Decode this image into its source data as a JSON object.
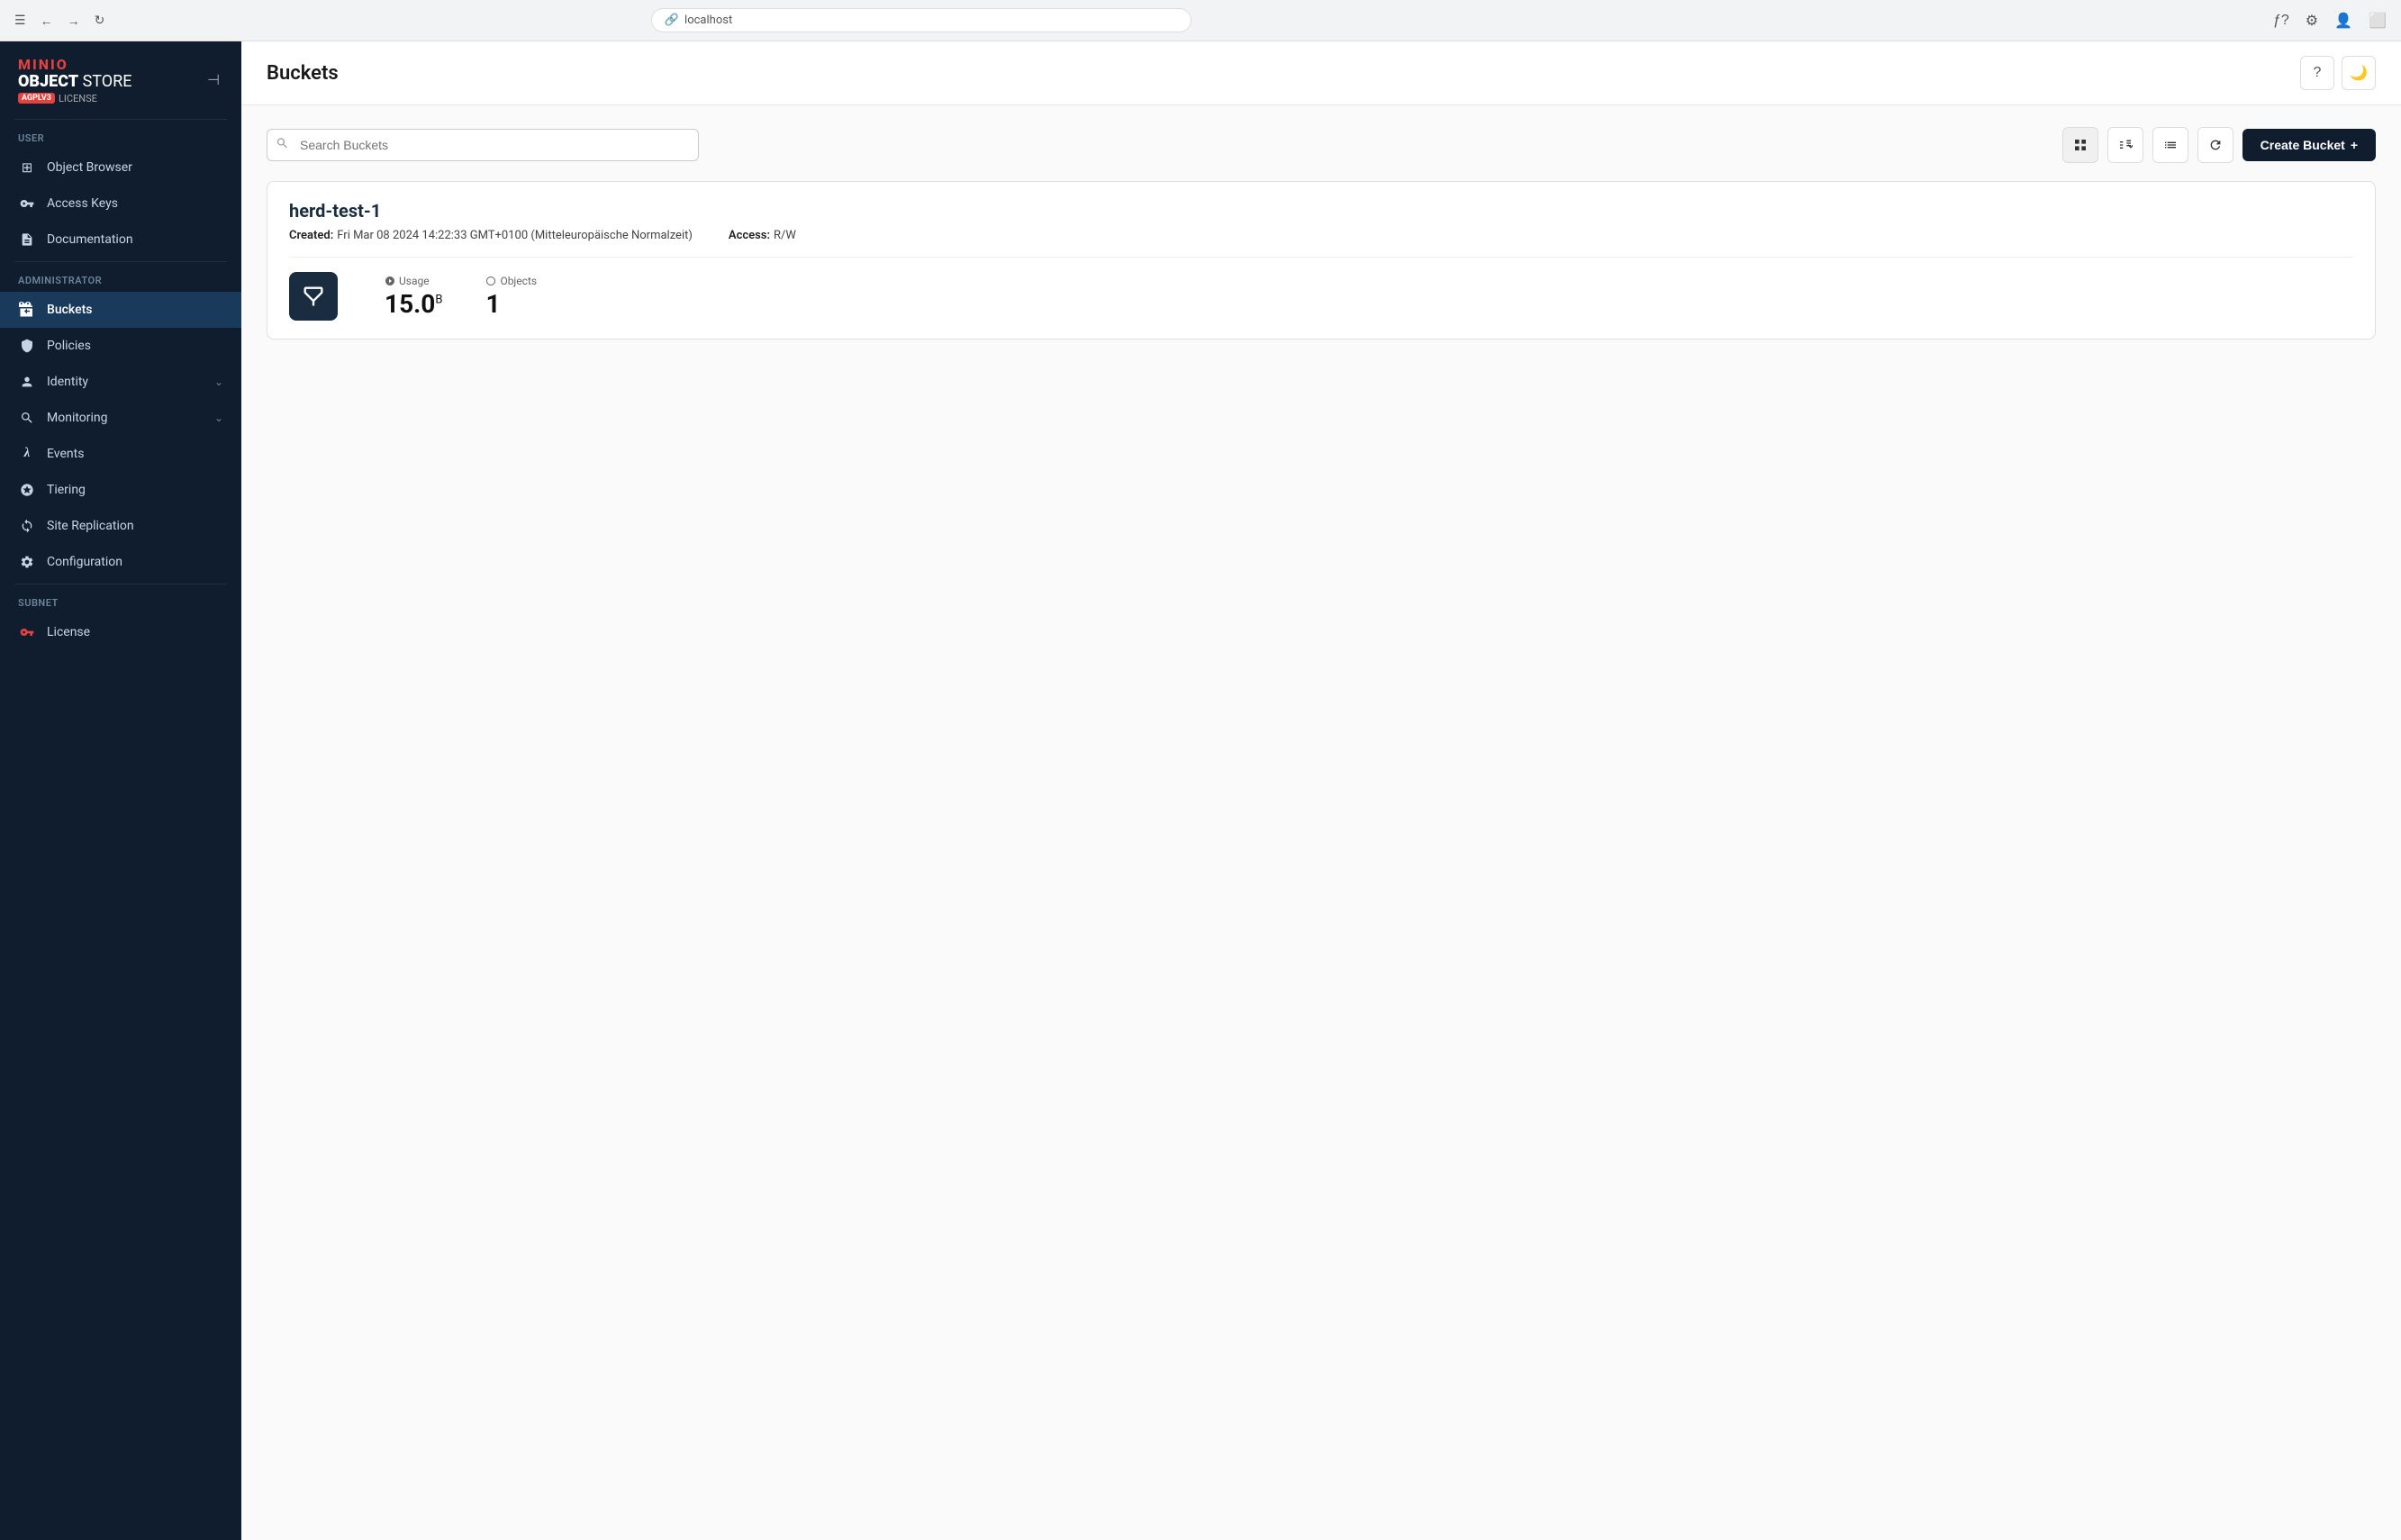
{
  "browser": {
    "address": "localhost",
    "address_icon": "🔗"
  },
  "header": {
    "title": "Buckets",
    "help_label": "?",
    "theme_label": "🌙"
  },
  "sidebar": {
    "logo": {
      "brand": "MINIO",
      "product_bold": "OBJECT",
      "product_light": " STORE",
      "license_badge": "AGPLV3",
      "license_text": "LICENSE"
    },
    "collapse_icon": "⊣",
    "user_section": "User",
    "user_items": [
      {
        "id": "object-browser",
        "icon": "⊞",
        "label": "Object Browser"
      },
      {
        "id": "access-keys",
        "icon": "🪪",
        "label": "Access Keys"
      },
      {
        "id": "documentation",
        "icon": "📄",
        "label": "Documentation"
      }
    ],
    "admin_section": "Administrator",
    "admin_items": [
      {
        "id": "buckets",
        "icon": "🗂",
        "label": "Buckets",
        "active": true
      },
      {
        "id": "policies",
        "icon": "🔒",
        "label": "Policies"
      },
      {
        "id": "identity",
        "icon": "🪪",
        "label": "Identity",
        "hasChevron": true
      },
      {
        "id": "monitoring",
        "icon": "🔍",
        "label": "Monitoring",
        "hasChevron": true
      },
      {
        "id": "events",
        "icon": "λ",
        "label": "Events"
      },
      {
        "id": "tiering",
        "icon": "⧉",
        "label": "Tiering"
      },
      {
        "id": "site-replication",
        "icon": "↺",
        "label": "Site Replication"
      },
      {
        "id": "configuration",
        "icon": "⚙",
        "label": "Configuration"
      }
    ],
    "subnet_section": "Subnet",
    "subnet_items": [
      {
        "id": "license",
        "icon": "🔑",
        "label": "License"
      }
    ]
  },
  "toolbar": {
    "search_placeholder": "Search Buckets",
    "create_bucket_label": "Create Bucket"
  },
  "bucket": {
    "name": "herd-test-1",
    "created_label": "Created:",
    "created_value": "Fri Mar 08 2024 14:22:33 GMT+0100 (Mitteleuropäische Normalzeit)",
    "access_label": "Access:",
    "access_value": "R/W",
    "usage_label": "Usage",
    "usage_value": "15.0",
    "usage_unit": "B",
    "objects_label": "Objects",
    "objects_value": "1"
  }
}
